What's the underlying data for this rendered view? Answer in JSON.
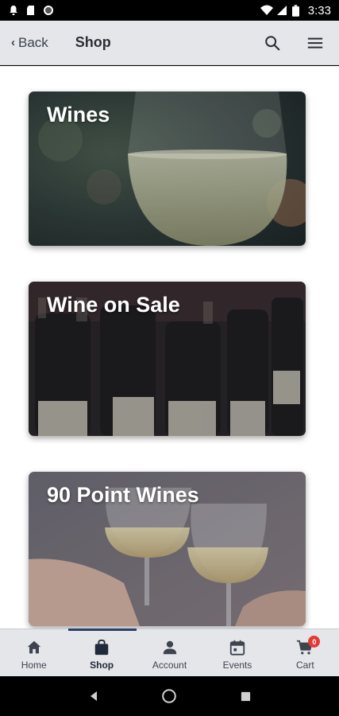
{
  "status_bar": {
    "time": "3:33",
    "icons": [
      "notification-bell-icon",
      "sd-card-icon",
      "circle-icon",
      "wifi-icon",
      "signal-icon",
      "battery-icon"
    ]
  },
  "app_bar": {
    "back_label": "Back",
    "title": "Shop",
    "actions": [
      "search-icon",
      "menu-icon"
    ]
  },
  "cards": [
    {
      "title": "Wines"
    },
    {
      "title": "Wine on Sale"
    },
    {
      "title": "90 Point Wines"
    }
  ],
  "bottom_nav": {
    "items": [
      {
        "label": "Home",
        "icon": "home-icon"
      },
      {
        "label": "Shop",
        "icon": "shopping-bag-icon"
      },
      {
        "label": "Account",
        "icon": "person-icon"
      },
      {
        "label": "Events",
        "icon": "calendar-icon"
      },
      {
        "label": "Cart",
        "icon": "cart-icon",
        "badge": "0"
      }
    ],
    "active": "Shop"
  },
  "colors": {
    "app_bar_bg": "#e4e6e9",
    "active_indicator": "#2c3e66",
    "badge": "#e53935"
  }
}
